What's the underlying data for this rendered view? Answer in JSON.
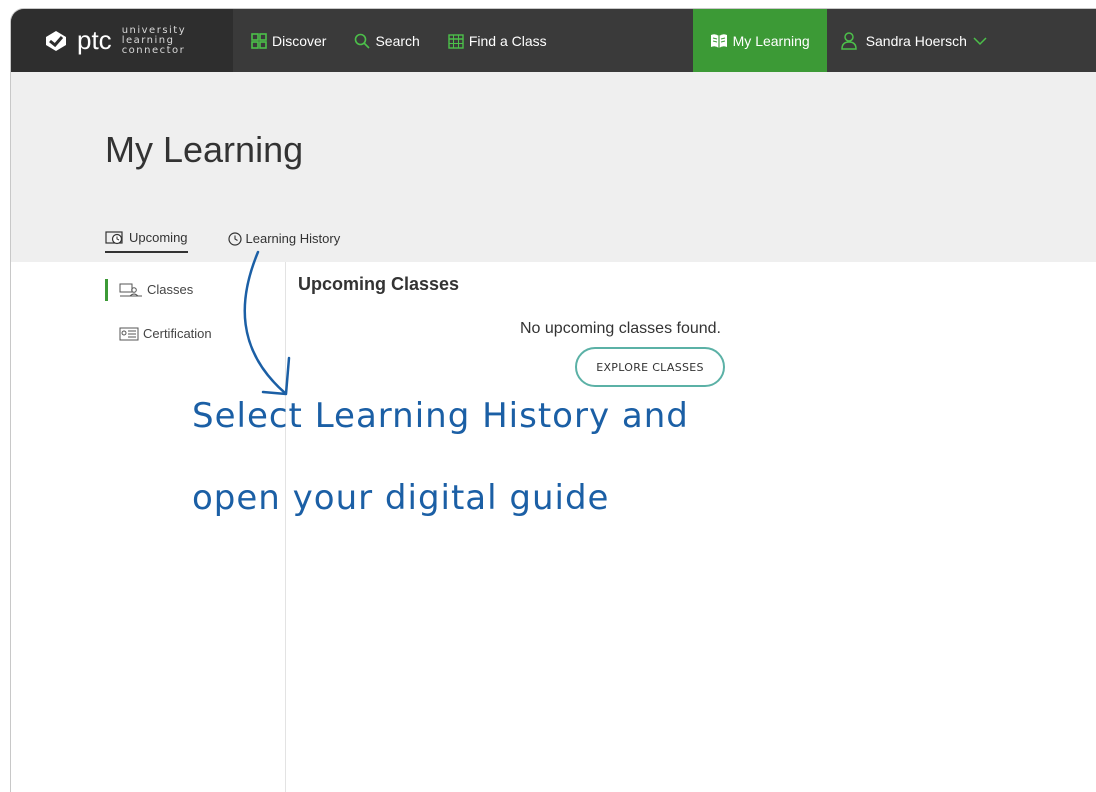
{
  "brand": {
    "name": "ptc",
    "tagline": [
      "university",
      "learning",
      "connector"
    ]
  },
  "nav": {
    "discover": "Discover",
    "search": "Search",
    "find_class": "Find a Class",
    "my_learning": "My Learning",
    "user": "Sandra Hoersch"
  },
  "page": {
    "title": "My Learning",
    "tabs": [
      {
        "label": "Upcoming",
        "active": true
      },
      {
        "label": "Learning History",
        "active": false
      }
    ]
  },
  "sidebar": {
    "items": [
      {
        "label": "Classes",
        "active": true
      },
      {
        "label": "Certification",
        "active": false
      }
    ]
  },
  "main": {
    "heading": "Upcoming Classes",
    "empty_message": "No upcoming classes found.",
    "explore_button": "EXPLORE CLASSES"
  },
  "annotation": {
    "line1": "Select Learning History and",
    "line2": "open your digital guide"
  },
  "colors": {
    "nav_bg": "#3a3a3a",
    "accent_green": "#3c9a36",
    "header_bg": "#efefef",
    "button_border": "#5bb1a6",
    "annotation_blue": "#1b5fa5"
  },
  "icons": {
    "discover": "grid-icon",
    "search": "search-icon",
    "find_class": "calendar-icon",
    "my_learning": "book-icon",
    "user": "user-icon"
  }
}
